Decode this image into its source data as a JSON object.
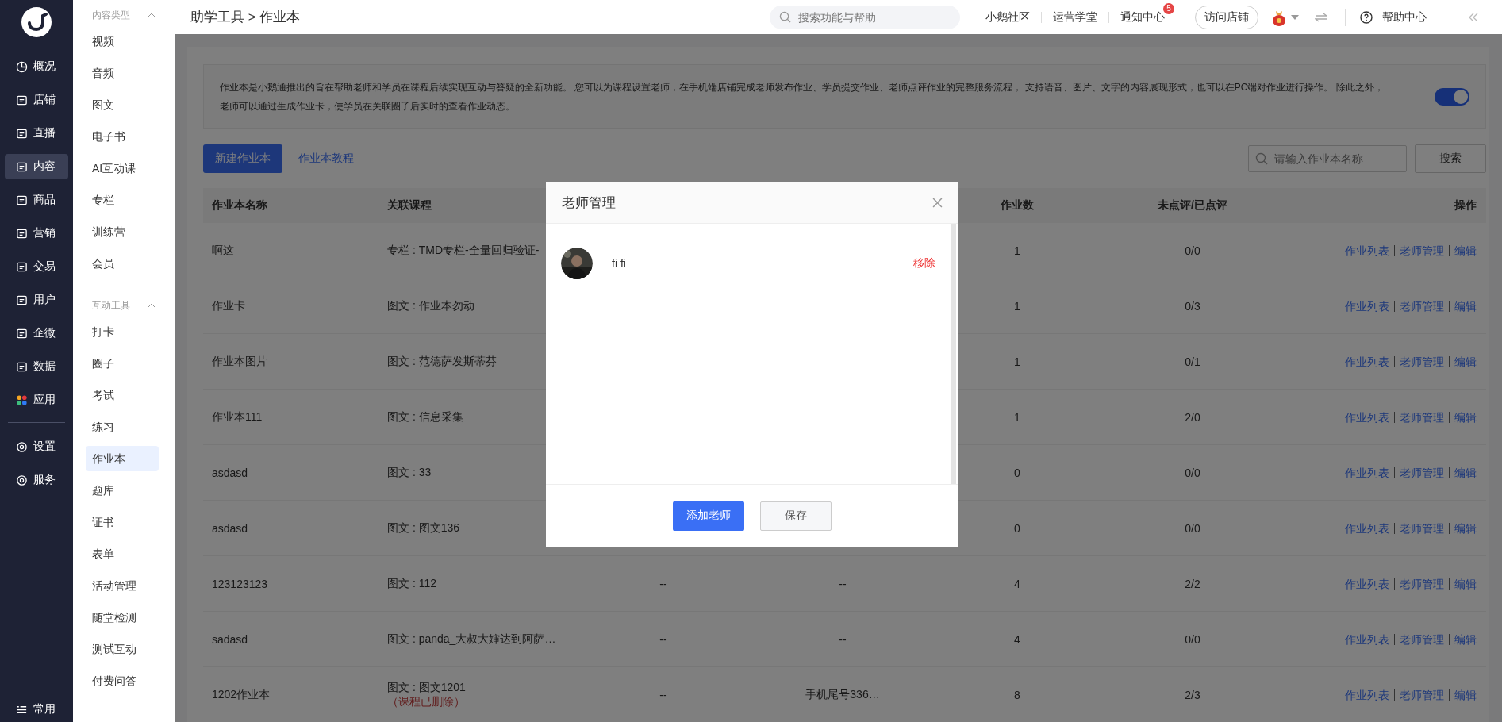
{
  "nav": {
    "items": [
      {
        "label": "概况",
        "selected": false
      },
      {
        "label": "店铺",
        "selected": false
      },
      {
        "label": "直播",
        "selected": false
      },
      {
        "label": "内容",
        "selected": true
      },
      {
        "label": "商品",
        "selected": false
      },
      {
        "label": "营销",
        "selected": false
      },
      {
        "label": "交易",
        "selected": false
      },
      {
        "label": "用户",
        "selected": false
      },
      {
        "label": "企微",
        "selected": false
      },
      {
        "label": "数据",
        "selected": false
      },
      {
        "label": "应用",
        "selected": false
      }
    ],
    "settings": [
      {
        "label": "设置",
        "selected": false
      },
      {
        "label": "服务",
        "selected": false
      }
    ],
    "bottom": {
      "label": "常用"
    }
  },
  "submenu": {
    "groups": [
      {
        "title": "内容类型",
        "expanded": true,
        "items": [
          {
            "label": "视频",
            "selected": false
          },
          {
            "label": "音频",
            "selected": false
          },
          {
            "label": "图文",
            "selected": false
          },
          {
            "label": "电子书",
            "selected": false
          },
          {
            "label": "AI互动课",
            "selected": false
          },
          {
            "label": "专栏",
            "selected": false
          },
          {
            "label": "训练营",
            "selected": false
          },
          {
            "label": "会员",
            "selected": false
          }
        ]
      },
      {
        "title": "互动工具",
        "expanded": true,
        "items": [
          {
            "label": "打卡",
            "selected": false
          },
          {
            "label": "圈子",
            "selected": false
          },
          {
            "label": "考试",
            "selected": false
          },
          {
            "label": "练习",
            "selected": false
          },
          {
            "label": "作业本",
            "selected": true
          },
          {
            "label": "题库",
            "selected": false
          },
          {
            "label": "证书",
            "selected": false
          },
          {
            "label": "表单",
            "selected": false
          },
          {
            "label": "活动管理",
            "selected": false
          },
          {
            "label": "随堂检测",
            "selected": false
          },
          {
            "label": "测试互动",
            "selected": false
          },
          {
            "label": "付费问答",
            "selected": false
          }
        ]
      }
    ]
  },
  "topbar": {
    "breadcrumb": "助学工具 > 作业本",
    "search": {
      "placeholder": "搜索功能与帮助"
    },
    "links": [
      {
        "label": "小鹅社区"
      },
      {
        "label": "运营学堂"
      },
      {
        "label": "通知中心",
        "badge": "5"
      }
    ],
    "visit_button": "访问店铺",
    "help": "帮助中心"
  },
  "intro": {
    "text": "作业本是小鹅通推出的旨在帮助老师和学员在课程后续实现互动与答疑的全新功能。 您可以为课程设置老师，在手机端店铺完成老师发布作业、学员提交作业、老师点评作业的完整服务流程， 支持语音、图片、文字的内容展现形式，也可以在PC端对作业进行操作。 除此之外，老师可以通过生成作业卡，使学员在关联圈子后实时的查看作业动态。",
    "toggle_on": true
  },
  "toolbar": {
    "new_button": "新建作业本",
    "tutorial_link": "作业本教程",
    "search": {
      "placeholder": "请输入作业本名称"
    },
    "search_button": "搜索"
  },
  "table": {
    "columns": [
      "作业本名称",
      "关联课程",
      "作业数",
      "未点评/已点评",
      "操作"
    ],
    "rows": [
      {
        "name": "啊这",
        "course": "专栏 : TMD专栏-全量回归验证-",
        "count": "1",
        "review": "0/0",
        "actions": [
          "作业列表",
          "老师管理",
          "编辑"
        ]
      },
      {
        "name": "作业卡",
        "course": "图文 : 作业本勿动",
        "count": "1",
        "review": "0/3",
        "actions": [
          "作业列表",
          "老师管理",
          "编辑"
        ]
      },
      {
        "name": "作业本图片",
        "course": "图文 : 范德萨发斯蒂芬",
        "count": "1",
        "review": "0/1",
        "actions": [
          "作业列表",
          "老师管理",
          "编辑"
        ]
      },
      {
        "name": "作业本111",
        "course": "图文 : 信息采集",
        "count": "1",
        "review": "2/0",
        "actions": [
          "作业列表",
          "老师管理",
          "编辑"
        ]
      },
      {
        "name": "asdasd",
        "course": "图文 : 33",
        "count": "0",
        "review": "0/0",
        "actions": [
          "作业列表",
          "老师管理",
          "编辑"
        ]
      },
      {
        "name": "asdasd",
        "course": "图文 : 图文136",
        "count": "0",
        "review": "0/0",
        "actions": [
          "作业列表",
          "老师管理",
          "编辑"
        ]
      },
      {
        "name": "123123123",
        "course": "图文 : 112",
        "column_3": "--",
        "column_4": "--",
        "count": "4",
        "review": "2/2",
        "actions": [
          "作业列表",
          "老师管理",
          "编辑"
        ]
      },
      {
        "name": "sadasd",
        "course": "图文 : panda_大叔大婶达到阿萨…",
        "column_3": "--",
        "column_4": "--",
        "count": "4",
        "review": "0/0",
        "actions": [
          "作业列表",
          "老师管理",
          "编辑"
        ]
      },
      {
        "name": "1202作业本",
        "course": "图文 : 图文1201",
        "course_note": "（课程已删除）",
        "column_3": "--",
        "column_4": "手机尾号336…",
        "count": "8",
        "review": "2/3",
        "actions": [
          "作业列表",
          "老师管理",
          "编辑"
        ]
      }
    ]
  },
  "modal": {
    "title": "老师管理",
    "teachers": [
      {
        "name": "fi fi",
        "action": "移除"
      }
    ],
    "buttons": [
      {
        "label": "添加老师",
        "kind": "primary"
      },
      {
        "label": "保存",
        "kind": "secondary"
      }
    ]
  }
}
